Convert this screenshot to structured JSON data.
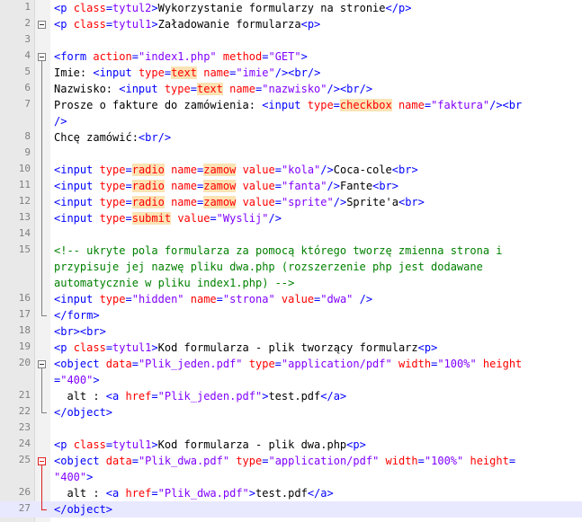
{
  "colors": {
    "tag": "#0000ff",
    "attribute": "#ff0000",
    "value": "#8000ff",
    "comment": "#008000",
    "highlight": "#fbe3b4",
    "gutter": "#e9e9e9",
    "current_line": "#e8e8ff",
    "fold_active": "#e02020"
  },
  "lines": [
    {
      "n": "1",
      "tokens": [
        [
          "tag",
          "<p "
        ],
        [
          "attr",
          "class"
        ],
        [
          "tag",
          "="
        ],
        [
          "val",
          "tytul2"
        ],
        [
          "tag",
          ">"
        ],
        [
          "txt",
          "Wykorzystanie formularzy na stronie"
        ],
        [
          "tag",
          "</p>"
        ]
      ]
    },
    {
      "n": "2",
      "tokens": [
        [
          "tag",
          "<p "
        ],
        [
          "attr",
          "class"
        ],
        [
          "tag",
          "="
        ],
        [
          "val",
          "tytul1"
        ],
        [
          "tag",
          ">"
        ],
        [
          "txt",
          "Załadowanie formularza"
        ],
        [
          "tag",
          "<p>"
        ]
      ]
    },
    {
      "n": "3",
      "tokens": []
    },
    {
      "n": "4",
      "tokens": [
        [
          "tag",
          "<form "
        ],
        [
          "attr",
          "action"
        ],
        [
          "tag",
          "="
        ],
        [
          "val",
          "\"index1.php\""
        ],
        [
          "tag",
          " "
        ],
        [
          "attr",
          "method"
        ],
        [
          "tag",
          "="
        ],
        [
          "val",
          "\"GET\""
        ],
        [
          "tag",
          ">"
        ]
      ]
    },
    {
      "n": "5",
      "tokens": [
        [
          "txt",
          "Imie: "
        ],
        [
          "tag",
          "<input "
        ],
        [
          "attr",
          "type"
        ],
        [
          "tag",
          "="
        ],
        [
          "hl",
          "text"
        ],
        [
          "tag",
          " "
        ],
        [
          "attr",
          "name"
        ],
        [
          "tag",
          "="
        ],
        [
          "val",
          "\"imie\""
        ],
        [
          "tag",
          "/><br/>"
        ]
      ]
    },
    {
      "n": "6",
      "tokens": [
        [
          "txt",
          "Nazwisko: "
        ],
        [
          "tag",
          "<input "
        ],
        [
          "attr",
          "type"
        ],
        [
          "tag",
          "="
        ],
        [
          "hl",
          "text"
        ],
        [
          "tag",
          " "
        ],
        [
          "attr",
          "name"
        ],
        [
          "tag",
          "="
        ],
        [
          "val",
          "\"nazwisko\""
        ],
        [
          "tag",
          "/><br/>"
        ]
      ]
    },
    {
      "n": "7",
      "tokens": [
        [
          "txt",
          "Prosze o fakture do zamówienia: "
        ],
        [
          "tag",
          "<input "
        ],
        [
          "attr",
          "type"
        ],
        [
          "tag",
          "="
        ],
        [
          "hl",
          "checkbox"
        ],
        [
          "tag",
          " "
        ],
        [
          "attr",
          "name"
        ],
        [
          "tag",
          "="
        ],
        [
          "val",
          "\"faktura\""
        ],
        [
          "tag",
          "/><br"
        ]
      ]
    },
    {
      "n": "",
      "tokens": [
        [
          "tag",
          "/>"
        ]
      ]
    },
    {
      "n": "8",
      "tokens": [
        [
          "txt",
          "Chcę zamówić:"
        ],
        [
          "tag",
          "<br/>"
        ]
      ]
    },
    {
      "n": "9",
      "tokens": []
    },
    {
      "n": "10",
      "tokens": [
        [
          "tag",
          "<input "
        ],
        [
          "attr",
          "type"
        ],
        [
          "tag",
          "="
        ],
        [
          "hl",
          "radio"
        ],
        [
          "tag",
          " "
        ],
        [
          "attr",
          "name"
        ],
        [
          "tag",
          "="
        ],
        [
          "hl",
          "zamow"
        ],
        [
          "tag",
          " "
        ],
        [
          "attr",
          "value"
        ],
        [
          "tag",
          "="
        ],
        [
          "val",
          "\"kola\""
        ],
        [
          "tag",
          "/>"
        ],
        [
          "txt",
          "Coca-cole"
        ],
        [
          "tag",
          "<br>"
        ]
      ]
    },
    {
      "n": "11",
      "tokens": [
        [
          "tag",
          "<input "
        ],
        [
          "attr",
          "type"
        ],
        [
          "tag",
          "="
        ],
        [
          "hl",
          "radio"
        ],
        [
          "tag",
          " "
        ],
        [
          "attr",
          "name"
        ],
        [
          "tag",
          "="
        ],
        [
          "hl",
          "zamow"
        ],
        [
          "tag",
          " "
        ],
        [
          "attr",
          "value"
        ],
        [
          "tag",
          "="
        ],
        [
          "val",
          "\"fanta\""
        ],
        [
          "tag",
          "/>"
        ],
        [
          "txt",
          "Fante"
        ],
        [
          "tag",
          "<br>"
        ]
      ]
    },
    {
      "n": "12",
      "tokens": [
        [
          "tag",
          "<input "
        ],
        [
          "attr",
          "type"
        ],
        [
          "tag",
          "="
        ],
        [
          "hl",
          "radio"
        ],
        [
          "tag",
          " "
        ],
        [
          "attr",
          "name"
        ],
        [
          "tag",
          "="
        ],
        [
          "hl",
          "zamow"
        ],
        [
          "tag",
          " "
        ],
        [
          "attr",
          "value"
        ],
        [
          "tag",
          "="
        ],
        [
          "val",
          "\"sprite\""
        ],
        [
          "tag",
          "/>"
        ],
        [
          "txt",
          "Sprite'a"
        ],
        [
          "tag",
          "<br>"
        ]
      ]
    },
    {
      "n": "13",
      "tokens": [
        [
          "tag",
          "<input "
        ],
        [
          "attr",
          "type"
        ],
        [
          "tag",
          "="
        ],
        [
          "hl",
          "submit"
        ],
        [
          "tag",
          " "
        ],
        [
          "attr",
          "value"
        ],
        [
          "tag",
          "="
        ],
        [
          "val",
          "\"Wyslij\""
        ],
        [
          "tag",
          "/>"
        ]
      ]
    },
    {
      "n": "14",
      "tokens": []
    },
    {
      "n": "15",
      "tokens": [
        [
          "cmt",
          "<!-- ukryte pola formularza za pomocą którego tworzę zmienna strona i"
        ]
      ]
    },
    {
      "n": "",
      "tokens": [
        [
          "cmt",
          "przypisuje jej nazwę pliku dwa.php (rozszerzenie php jest dodawane"
        ]
      ]
    },
    {
      "n": "",
      "tokens": [
        [
          "cmt",
          "automatycznie w pliku index1.php) -->"
        ]
      ]
    },
    {
      "n": "16",
      "tokens": [
        [
          "tag",
          "<input "
        ],
        [
          "attr",
          "type"
        ],
        [
          "tag",
          "="
        ],
        [
          "val",
          "\"hidden\""
        ],
        [
          "tag",
          " "
        ],
        [
          "attr",
          "name"
        ],
        [
          "tag",
          "="
        ],
        [
          "val",
          "\"strona\""
        ],
        [
          "tag",
          " "
        ],
        [
          "attr",
          "value"
        ],
        [
          "tag",
          "="
        ],
        [
          "val",
          "\"dwa\""
        ],
        [
          "tag",
          " />"
        ]
      ]
    },
    {
      "n": "17",
      "tokens": [
        [
          "tag",
          "</form>"
        ]
      ]
    },
    {
      "n": "18",
      "tokens": [
        [
          "tag",
          "<br><br>"
        ]
      ]
    },
    {
      "n": "19",
      "tokens": [
        [
          "tag",
          "<p "
        ],
        [
          "attr",
          "class"
        ],
        [
          "tag",
          "="
        ],
        [
          "val",
          "tytul1"
        ],
        [
          "tag",
          ">"
        ],
        [
          "txt",
          "Kod formularza - plik tworzący formularz"
        ],
        [
          "tag",
          "<p>"
        ]
      ]
    },
    {
      "n": "20",
      "tokens": [
        [
          "tag",
          "<object "
        ],
        [
          "attr",
          "data"
        ],
        [
          "tag",
          "="
        ],
        [
          "val",
          "\"Plik_jeden.pdf\""
        ],
        [
          "tag",
          " "
        ],
        [
          "attr",
          "type"
        ],
        [
          "tag",
          "="
        ],
        [
          "val",
          "\"application/pdf\""
        ],
        [
          "tag",
          " "
        ],
        [
          "attr",
          "width"
        ],
        [
          "tag",
          "="
        ],
        [
          "val",
          "\"100%\""
        ],
        [
          "tag",
          " "
        ],
        [
          "attr",
          "height"
        ]
      ]
    },
    {
      "n": "",
      "tokens": [
        [
          "tag",
          "="
        ],
        [
          "val",
          "\"400\""
        ],
        [
          "tag",
          ">"
        ]
      ]
    },
    {
      "n": "21",
      "tokens": [
        [
          "txt",
          "  alt : "
        ],
        [
          "tag",
          "<a "
        ],
        [
          "attr",
          "href"
        ],
        [
          "tag",
          "="
        ],
        [
          "val",
          "\"Plik_jeden.pdf\""
        ],
        [
          "tag",
          ">"
        ],
        [
          "txt",
          "test.pdf"
        ],
        [
          "tag",
          "</a>"
        ]
      ]
    },
    {
      "n": "22",
      "tokens": [
        [
          "tag",
          "</object>"
        ]
      ]
    },
    {
      "n": "23",
      "tokens": []
    },
    {
      "n": "24",
      "tokens": [
        [
          "tag",
          "<p "
        ],
        [
          "attr",
          "class"
        ],
        [
          "tag",
          "="
        ],
        [
          "val",
          "tytul1"
        ],
        [
          "tag",
          ">"
        ],
        [
          "txt",
          "Kod formularza - plik dwa.php"
        ],
        [
          "tag",
          "<p>"
        ]
      ]
    },
    {
      "n": "25",
      "tokens": [
        [
          "tag",
          "<object "
        ],
        [
          "attr",
          "data"
        ],
        [
          "tag",
          "="
        ],
        [
          "val",
          "\"Plik_dwa.pdf\""
        ],
        [
          "tag",
          " "
        ],
        [
          "attr",
          "type"
        ],
        [
          "tag",
          "="
        ],
        [
          "val",
          "\"application/pdf\""
        ],
        [
          "tag",
          " "
        ],
        [
          "attr",
          "width"
        ],
        [
          "tag",
          "="
        ],
        [
          "val",
          "\"100%\""
        ],
        [
          "tag",
          " "
        ],
        [
          "attr",
          "height"
        ],
        [
          "tag",
          "="
        ]
      ]
    },
    {
      "n": "",
      "tokens": [
        [
          "val",
          "\"400\""
        ],
        [
          "tag",
          ">"
        ]
      ]
    },
    {
      "n": "26",
      "tokens": [
        [
          "txt",
          "  alt : "
        ],
        [
          "tag",
          "<a "
        ],
        [
          "attr",
          "href"
        ],
        [
          "tag",
          "="
        ],
        [
          "val",
          "\"Plik_dwa.pdf\""
        ],
        [
          "tag",
          ">"
        ],
        [
          "txt",
          "test.pdf"
        ],
        [
          "tag",
          "</a>"
        ]
      ]
    },
    {
      "n": "27",
      "tokens": [
        [
          "tag",
          "</object>"
        ]
      ]
    }
  ]
}
